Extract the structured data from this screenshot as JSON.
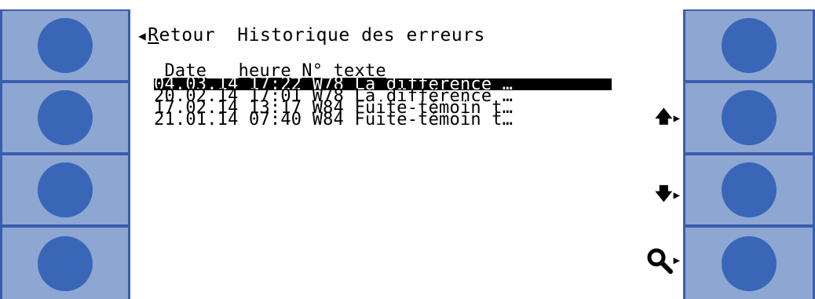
{
  "screen": {
    "back_icon": "triangle-left-icon",
    "back_label_first": "R",
    "back_label_rest": "etour",
    "title": "Historique des erreurs"
  },
  "table": {
    "columns": [
      "Date",
      "heure",
      "N°",
      "texte"
    ],
    "rows": [
      {
        "date": "04.03.14",
        "time": "17:22",
        "code": "W78",
        "text": "La différence …",
        "selected": true
      },
      {
        "date": "20.02.14",
        "time": "17:01",
        "code": "W78",
        "text": "La différence …",
        "selected": false
      },
      {
        "date": "17.02.14",
        "time": "13:17",
        "code": "W84",
        "text": "Fuite-témoin t…",
        "selected": false
      },
      {
        "date": "21.01.14",
        "time": "07:40",
        "code": "W84",
        "text": "Fuite-témoin t…",
        "selected": false
      }
    ]
  },
  "nav": {
    "up_icon": "arrow-up-icon",
    "down_icon": "arrow-down-icon",
    "search_icon": "magnifier-icon"
  },
  "colors": {
    "panel_dark": "#3a5eae",
    "panel_light": "#8ea6d2",
    "button_circle": "#3a66b8"
  }
}
